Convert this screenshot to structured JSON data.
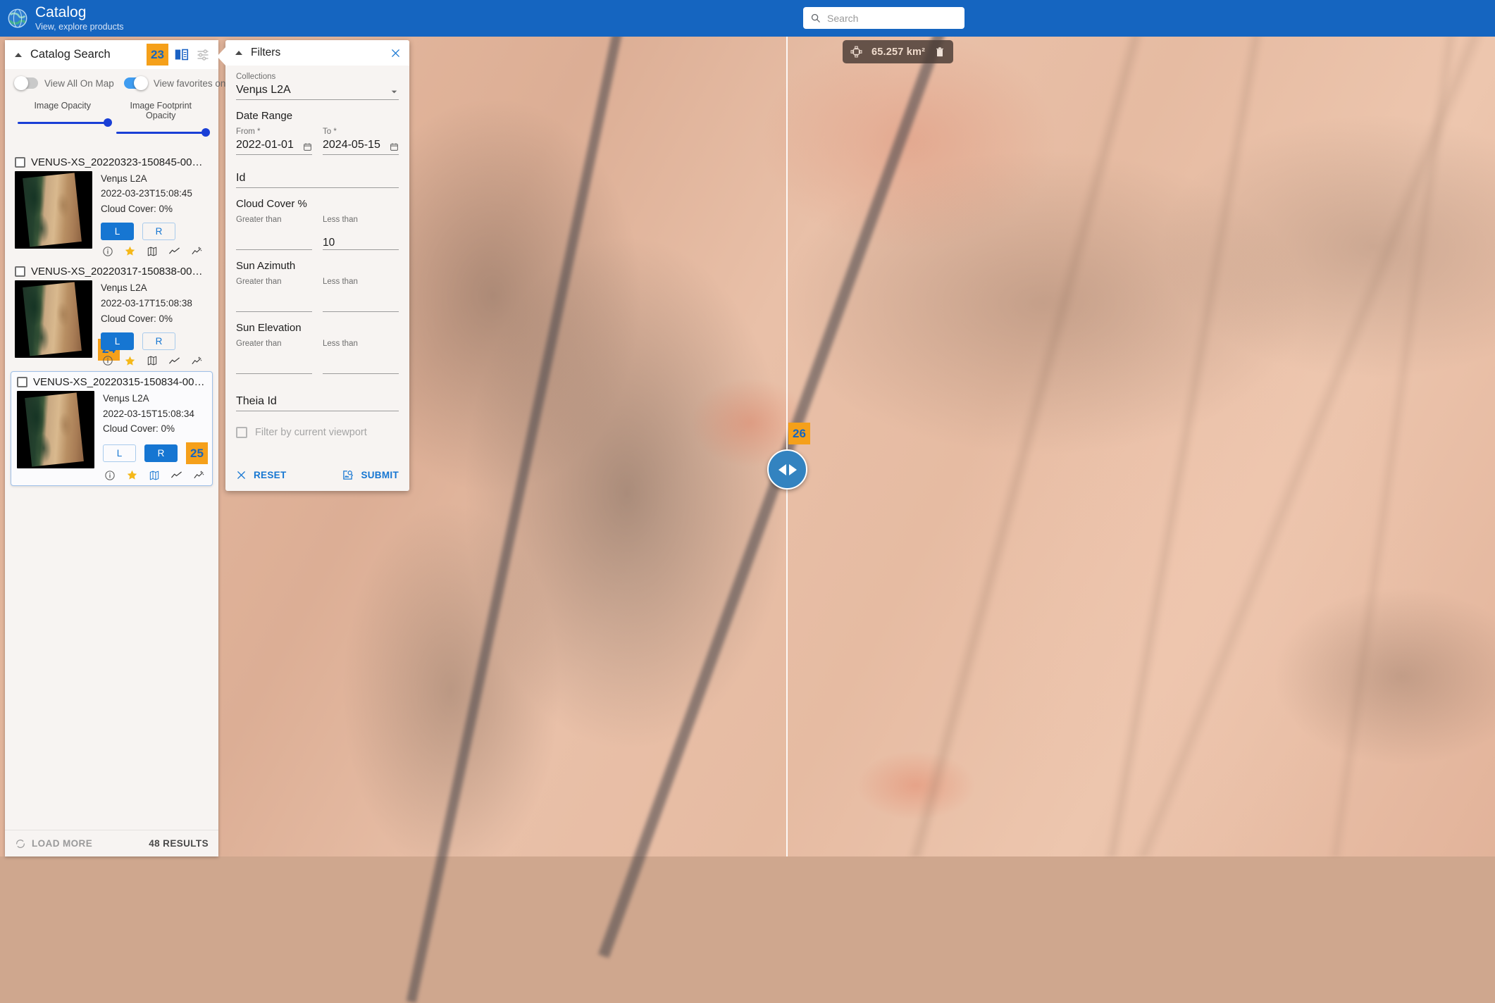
{
  "topbar": {
    "logo_icon": "globe-icon",
    "title": "Catalog",
    "subtitle": "View, explore products",
    "search": {
      "icon": "search-icon",
      "value": "",
      "placeholder": "Search"
    }
  },
  "sidebar": {
    "title": "Catalog Search",
    "collapse_icon": "caret-up-icon",
    "badge": "23",
    "icons": [
      {
        "name": "compare-split-icon",
        "color": "#1a62c4"
      },
      {
        "name": "tune-sliders-icon",
        "color": "#bdbdbd"
      }
    ],
    "toggles": [
      {
        "label": "View All On Map",
        "state": "off"
      },
      {
        "label": "View favorites only",
        "state": "on"
      }
    ],
    "overflow_icon": "kebab-menu-icon",
    "sliders": [
      {
        "label": "Image Opacity",
        "value": 100
      },
      {
        "label": "Image Footprint Opacity",
        "value": 100
      }
    ],
    "results": [
      {
        "title": "VENUS-XS_20220323-150845-00…",
        "collection": "Venµs L2A",
        "datetime": "2022-03-23T15:08:45",
        "cloud": "Cloud Cover: 0%",
        "left_label": "L",
        "right_label": "R",
        "active_side": "L",
        "badge": "24",
        "selected": false,
        "actions": [
          "info-icon",
          "star-icon",
          "map-icon",
          "timeline-icon",
          "auto-graph-icon"
        ]
      },
      {
        "title": "VENUS-XS_20220317-150838-00…",
        "collection": "Venµs L2A",
        "datetime": "2022-03-17T15:08:38",
        "cloud": "Cloud Cover: 0%",
        "left_label": "L",
        "right_label": "R",
        "active_side": "L",
        "badge": "",
        "selected": false,
        "actions": [
          "info-icon",
          "star-icon",
          "map-icon",
          "timeline-icon",
          "auto-graph-icon"
        ]
      },
      {
        "title": "VENUS-XS_20220315-150834-00…",
        "collection": "Venµs L2A",
        "datetime": "2022-03-15T15:08:34",
        "cloud": "Cloud Cover: 0%",
        "left_label": "L",
        "right_label": "R",
        "active_side": "R",
        "badge": "25",
        "selected": true,
        "actions": [
          "info-icon",
          "star-icon",
          "map-icon",
          "timeline-icon",
          "auto-graph-icon"
        ]
      }
    ],
    "footer": {
      "load_more": "LOAD MORE",
      "load_more_icon": "refresh-icon",
      "results_count": "48 RESULTS"
    }
  },
  "filters": {
    "title": "Filters",
    "collapse_icon": "caret-up-icon",
    "close_icon": "close-icon",
    "collections": {
      "label": "Collections",
      "value": "Venµs L2A",
      "dropdown_icon": "chevron-down-icon"
    },
    "date_range": {
      "title": "Date Range",
      "from": {
        "label": "From *",
        "value": "2022-01-01",
        "icon": "calendar-icon"
      },
      "to": {
        "label": "To *",
        "value": "2024-05-15",
        "icon": "calendar-icon"
      }
    },
    "id": {
      "label": "Id",
      "value": ""
    },
    "cloud_cover": {
      "title": "Cloud Cover %",
      "greater_label": "Greater than",
      "greater_value": "",
      "less_label": "Less than",
      "less_value": "10"
    },
    "sun_azimuth": {
      "title": "Sun Azimuth",
      "greater_label": "Greater than",
      "greater_value": "",
      "less_label": "Less than",
      "less_value": ""
    },
    "sun_elevation": {
      "title": "Sun Elevation",
      "greater_label": "Greater than",
      "greater_value": "",
      "less_label": "Less than",
      "less_value": ""
    },
    "theia_id": {
      "label": "Theia Id",
      "value": ""
    },
    "viewport_filter": {
      "label": "Filter by current viewport",
      "checked": false
    },
    "reset": {
      "label": "RESET",
      "icon": "close-icon"
    },
    "submit": {
      "label": "SUBMIT",
      "icon": "image-search-icon"
    }
  },
  "map": {
    "area_badge": {
      "icon": "polygon-icon",
      "value": "65.257 km²",
      "delete_icon": "trash-icon"
    },
    "swipe_handle": {
      "icon": "swipe-left-right-icon",
      "badge": "26"
    }
  },
  "colors": {
    "primary": "#1565c0",
    "accent_blue": "#1676d2",
    "badge_orange": "#f5a01a",
    "badge_text": "#1565c0",
    "star_yellow": "#f5b819"
  }
}
